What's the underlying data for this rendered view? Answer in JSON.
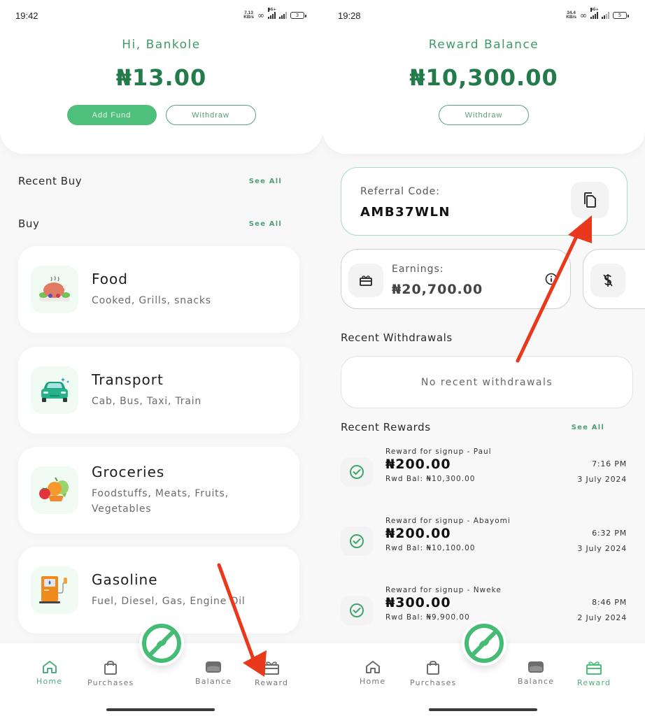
{
  "left_screen": {
    "status": {
      "time": "19:42",
      "net_speed": "7.13",
      "net_unit": "KB/s",
      "network": "4G+",
      "battery": "3"
    },
    "header": {
      "greeting": "Hi, Bankole",
      "balance": "₦13.00",
      "add_fund_label": "Add Fund",
      "withdraw_label": "Withdraw"
    },
    "recent_buy": {
      "title": "Recent Buy",
      "see_all": "See All"
    },
    "buy": {
      "title": "Buy",
      "see_all": "See All"
    },
    "categories": [
      {
        "icon": "roast-chicken-icon",
        "title": "Food",
        "subtitle": "Cooked, Grills, snacks"
      },
      {
        "icon": "car-icon",
        "title": "Transport",
        "subtitle": "Cab, Bus, Taxi, Train"
      },
      {
        "icon": "fruits-vegetables-icon",
        "title": "Groceries",
        "subtitle": "Foodstuffs, Meats, Fruits, Vegetables"
      },
      {
        "icon": "fuel-pump-icon",
        "title": "Gasoline",
        "subtitle": "Fuel, Diesel, Gas, Engine Oil"
      }
    ],
    "nav": {
      "active": "Home",
      "items": [
        {
          "icon": "home-icon",
          "label": "Home"
        },
        {
          "icon": "shopping-bag-icon",
          "label": "Purchases"
        },
        {
          "icon": "wallet-icon",
          "label": "Balance"
        },
        {
          "icon": "gift-icon",
          "label": "Reward"
        }
      ]
    }
  },
  "right_screen": {
    "status": {
      "time": "19:28",
      "net_speed": "34.4",
      "net_unit": "KB/s",
      "network": "4G+",
      "battery": "5"
    },
    "header": {
      "title": "Reward Balance",
      "balance": "₦10,300.00",
      "withdraw_label": "Withdraw"
    },
    "referral": {
      "label": "Referral Code:",
      "code": "AMB37WLN",
      "copy_icon": "copy-icon"
    },
    "earnings": {
      "label": "Earnings:",
      "value": "₦20,700.00",
      "icon": "gift-icon",
      "info_icon": "info-icon"
    },
    "second_card": {
      "icon": "no-dollar-icon"
    },
    "recent_withdrawals": {
      "title": "Recent Withdrawals",
      "empty_text": "No recent withdrawals"
    },
    "recent_rewards": {
      "title": "Recent Rewards",
      "see_all": "See All",
      "items": [
        {
          "description": "Reward for signup - Paul",
          "amount": "₦200.00",
          "balance": "Rwd Bal: ₦10,300.00",
          "time": "7:16 PM",
          "date": "3 July 2024"
        },
        {
          "description": "Reward for signup - Abayomi",
          "amount": "₦200.00",
          "balance": "Rwd Bal: ₦10,100.00",
          "time": "6:32 PM",
          "date": "3 July 2024"
        },
        {
          "description": "Reward for signup - Nweke",
          "amount": "₦300.00",
          "balance": "Rwd Bal: ₦9,900.00",
          "time": "8:46 PM",
          "date": "2 July 2024"
        }
      ]
    },
    "nav": {
      "active": "Reward",
      "items": [
        {
          "icon": "home-icon",
          "label": "Home"
        },
        {
          "icon": "shopping-bag-icon",
          "label": "Purchases"
        },
        {
          "icon": "wallet-icon",
          "label": "Balance"
        },
        {
          "icon": "gift-icon",
          "label": "Reward"
        }
      ]
    }
  },
  "colors": {
    "brand_green": "#4fbf7c",
    "balance_green": "#237a4b",
    "accent_text": "#3f9a6c",
    "annotation_red": "#e8391c"
  }
}
